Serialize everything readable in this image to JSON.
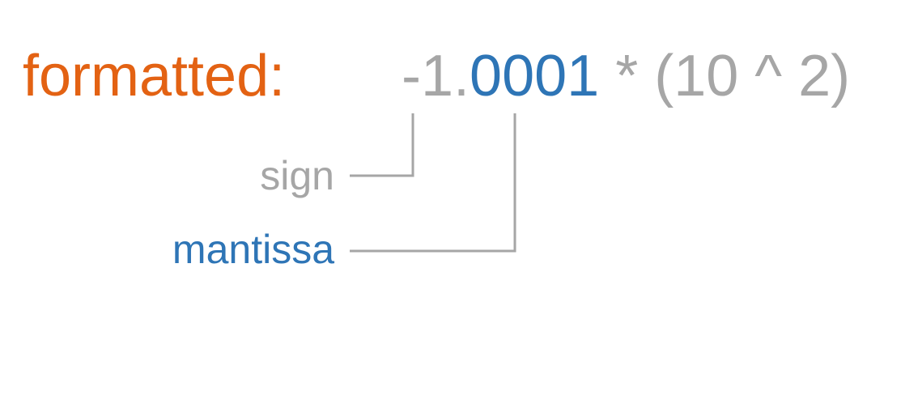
{
  "colors": {
    "label_orange": "#e36213",
    "gray": "#a6a6a6",
    "blue": "#2e75b6",
    "connector": "#a6a6a6"
  },
  "formatted_label": "formatted:",
  "formula": {
    "sign_and_leading": "-1.",
    "mantissa_digits": "0001",
    "exponent_part": " * (10 ^ 2)"
  },
  "annotations": {
    "sign": "sign",
    "mantissa": "mantissa"
  }
}
